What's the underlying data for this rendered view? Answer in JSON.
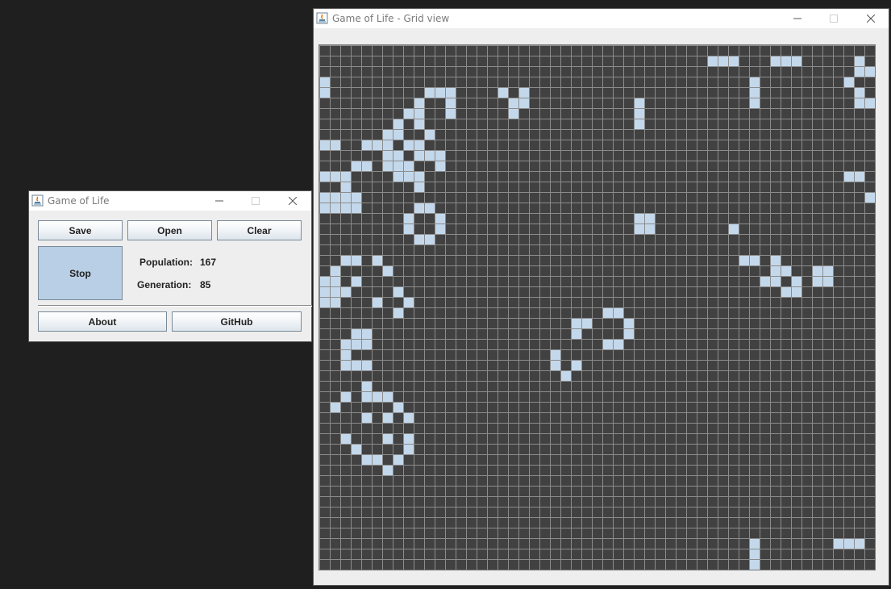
{
  "control_window": {
    "title": "Game of Life",
    "buttons": {
      "save": "Save",
      "open": "Open",
      "clear": "Clear",
      "stop": "Stop",
      "about": "About",
      "github": "GitHub"
    },
    "population_label": "Population:",
    "population_value": "167",
    "generation_label": "Generation:",
    "generation_value": "85"
  },
  "grid_window": {
    "title": "Game of Life - Grid view"
  },
  "colors": {
    "alive_cell": "#c4d8eb",
    "dead_cell": "#414141",
    "grid_line": "#8c8c8c",
    "stop_button": "#b8cfe5"
  },
  "grid": {
    "cols": 53,
    "rows": 50,
    "alive_cells": [
      [
        37,
        1
      ],
      [
        38,
        1
      ],
      [
        39,
        1
      ],
      [
        43,
        1
      ],
      [
        44,
        1
      ],
      [
        45,
        1
      ],
      [
        51,
        1
      ],
      [
        51,
        2
      ],
      [
        52,
        2
      ],
      [
        0,
        3
      ],
      [
        41,
        3
      ],
      [
        50,
        3
      ],
      [
        0,
        4
      ],
      [
        10,
        4
      ],
      [
        11,
        4
      ],
      [
        12,
        4
      ],
      [
        17,
        4
      ],
      [
        19,
        4
      ],
      [
        41,
        4
      ],
      [
        51,
        4
      ],
      [
        9,
        5
      ],
      [
        12,
        5
      ],
      [
        18,
        5
      ],
      [
        19,
        5
      ],
      [
        30,
        5
      ],
      [
        41,
        5
      ],
      [
        51,
        5
      ],
      [
        52,
        5
      ],
      [
        8,
        6
      ],
      [
        9,
        6
      ],
      [
        12,
        6
      ],
      [
        18,
        6
      ],
      [
        30,
        6
      ],
      [
        7,
        7
      ],
      [
        9,
        7
      ],
      [
        30,
        7
      ],
      [
        6,
        8
      ],
      [
        7,
        8
      ],
      [
        10,
        8
      ],
      [
        0,
        9
      ],
      [
        1,
        9
      ],
      [
        4,
        9
      ],
      [
        5,
        9
      ],
      [
        6,
        9
      ],
      [
        8,
        9
      ],
      [
        9,
        9
      ],
      [
        6,
        10
      ],
      [
        7,
        10
      ],
      [
        9,
        10
      ],
      [
        10,
        10
      ],
      [
        11,
        10
      ],
      [
        3,
        11
      ],
      [
        4,
        11
      ],
      [
        6,
        11
      ],
      [
        7,
        11
      ],
      [
        8,
        11
      ],
      [
        11,
        11
      ],
      [
        0,
        12
      ],
      [
        1,
        12
      ],
      [
        2,
        12
      ],
      [
        7,
        12
      ],
      [
        8,
        12
      ],
      [
        9,
        12
      ],
      [
        50,
        12
      ],
      [
        51,
        12
      ],
      [
        2,
        13
      ],
      [
        9,
        13
      ],
      [
        0,
        14
      ],
      [
        1,
        14
      ],
      [
        2,
        14
      ],
      [
        3,
        14
      ],
      [
        52,
        14
      ],
      [
        0,
        15
      ],
      [
        1,
        15
      ],
      [
        2,
        15
      ],
      [
        3,
        15
      ],
      [
        9,
        15
      ],
      [
        10,
        15
      ],
      [
        8,
        16
      ],
      [
        11,
        16
      ],
      [
        30,
        16
      ],
      [
        31,
        16
      ],
      [
        8,
        17
      ],
      [
        11,
        17
      ],
      [
        30,
        17
      ],
      [
        31,
        17
      ],
      [
        39,
        17
      ],
      [
        9,
        18
      ],
      [
        10,
        18
      ],
      [
        2,
        20
      ],
      [
        3,
        20
      ],
      [
        5,
        20
      ],
      [
        40,
        20
      ],
      [
        41,
        20
      ],
      [
        43,
        20
      ],
      [
        1,
        21
      ],
      [
        6,
        21
      ],
      [
        43,
        21
      ],
      [
        44,
        21
      ],
      [
        47,
        21
      ],
      [
        48,
        21
      ],
      [
        0,
        22
      ],
      [
        1,
        22
      ],
      [
        3,
        22
      ],
      [
        42,
        22
      ],
      [
        43,
        22
      ],
      [
        45,
        22
      ],
      [
        47,
        22
      ],
      [
        48,
        22
      ],
      [
        0,
        23
      ],
      [
        1,
        23
      ],
      [
        2,
        23
      ],
      [
        7,
        23
      ],
      [
        44,
        23
      ],
      [
        45,
        23
      ],
      [
        0,
        24
      ],
      [
        1,
        24
      ],
      [
        5,
        24
      ],
      [
        8,
        24
      ],
      [
        7,
        25
      ],
      [
        27,
        25
      ],
      [
        28,
        25
      ],
      [
        24,
        26
      ],
      [
        25,
        26
      ],
      [
        29,
        26
      ],
      [
        3,
        27
      ],
      [
        4,
        27
      ],
      [
        24,
        27
      ],
      [
        29,
        27
      ],
      [
        3,
        28
      ],
      [
        4,
        28
      ],
      [
        2,
        28
      ],
      [
        27,
        28
      ],
      [
        28,
        28
      ],
      [
        2,
        29
      ],
      [
        22,
        29
      ],
      [
        2,
        30
      ],
      [
        3,
        30
      ],
      [
        4,
        30
      ],
      [
        22,
        30
      ],
      [
        24,
        30
      ],
      [
        23,
        31
      ],
      [
        4,
        32
      ],
      [
        2,
        33
      ],
      [
        4,
        33
      ],
      [
        5,
        33
      ],
      [
        6,
        33
      ],
      [
        1,
        34
      ],
      [
        7,
        34
      ],
      [
        4,
        35
      ],
      [
        6,
        35
      ],
      [
        8,
        35
      ],
      [
        2,
        37
      ],
      [
        6,
        37
      ],
      [
        8,
        37
      ],
      [
        3,
        38
      ],
      [
        8,
        38
      ],
      [
        4,
        39
      ],
      [
        5,
        39
      ],
      [
        7,
        39
      ],
      [
        6,
        40
      ],
      [
        41,
        47
      ],
      [
        49,
        47
      ],
      [
        50,
        47
      ],
      [
        51,
        47
      ],
      [
        41,
        48
      ],
      [
        41,
        49
      ]
    ]
  }
}
